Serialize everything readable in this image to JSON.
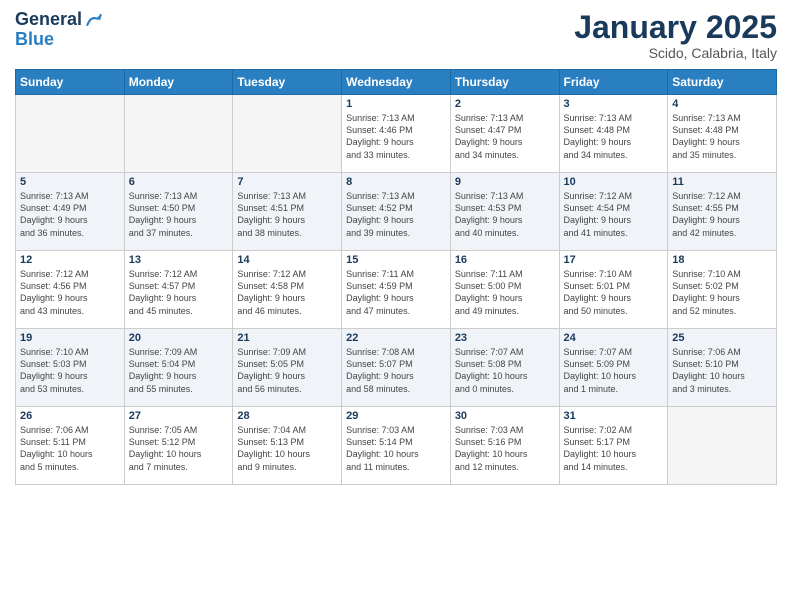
{
  "logo": {
    "general": "General",
    "blue": "Blue"
  },
  "title": "January 2025",
  "subtitle": "Scido, Calabria, Italy",
  "weekdays": [
    "Sunday",
    "Monday",
    "Tuesday",
    "Wednesday",
    "Thursday",
    "Friday",
    "Saturday"
  ],
  "weeks": [
    [
      {
        "day": "",
        "info": ""
      },
      {
        "day": "",
        "info": ""
      },
      {
        "day": "",
        "info": ""
      },
      {
        "day": "1",
        "info": "Sunrise: 7:13 AM\nSunset: 4:46 PM\nDaylight: 9 hours\nand 33 minutes."
      },
      {
        "day": "2",
        "info": "Sunrise: 7:13 AM\nSunset: 4:47 PM\nDaylight: 9 hours\nand 34 minutes."
      },
      {
        "day": "3",
        "info": "Sunrise: 7:13 AM\nSunset: 4:48 PM\nDaylight: 9 hours\nand 34 minutes."
      },
      {
        "day": "4",
        "info": "Sunrise: 7:13 AM\nSunset: 4:48 PM\nDaylight: 9 hours\nand 35 minutes."
      }
    ],
    [
      {
        "day": "5",
        "info": "Sunrise: 7:13 AM\nSunset: 4:49 PM\nDaylight: 9 hours\nand 36 minutes."
      },
      {
        "day": "6",
        "info": "Sunrise: 7:13 AM\nSunset: 4:50 PM\nDaylight: 9 hours\nand 37 minutes."
      },
      {
        "day": "7",
        "info": "Sunrise: 7:13 AM\nSunset: 4:51 PM\nDaylight: 9 hours\nand 38 minutes."
      },
      {
        "day": "8",
        "info": "Sunrise: 7:13 AM\nSunset: 4:52 PM\nDaylight: 9 hours\nand 39 minutes."
      },
      {
        "day": "9",
        "info": "Sunrise: 7:13 AM\nSunset: 4:53 PM\nDaylight: 9 hours\nand 40 minutes."
      },
      {
        "day": "10",
        "info": "Sunrise: 7:12 AM\nSunset: 4:54 PM\nDaylight: 9 hours\nand 41 minutes."
      },
      {
        "day": "11",
        "info": "Sunrise: 7:12 AM\nSunset: 4:55 PM\nDaylight: 9 hours\nand 42 minutes."
      }
    ],
    [
      {
        "day": "12",
        "info": "Sunrise: 7:12 AM\nSunset: 4:56 PM\nDaylight: 9 hours\nand 43 minutes."
      },
      {
        "day": "13",
        "info": "Sunrise: 7:12 AM\nSunset: 4:57 PM\nDaylight: 9 hours\nand 45 minutes."
      },
      {
        "day": "14",
        "info": "Sunrise: 7:12 AM\nSunset: 4:58 PM\nDaylight: 9 hours\nand 46 minutes."
      },
      {
        "day": "15",
        "info": "Sunrise: 7:11 AM\nSunset: 4:59 PM\nDaylight: 9 hours\nand 47 minutes."
      },
      {
        "day": "16",
        "info": "Sunrise: 7:11 AM\nSunset: 5:00 PM\nDaylight: 9 hours\nand 49 minutes."
      },
      {
        "day": "17",
        "info": "Sunrise: 7:10 AM\nSunset: 5:01 PM\nDaylight: 9 hours\nand 50 minutes."
      },
      {
        "day": "18",
        "info": "Sunrise: 7:10 AM\nSunset: 5:02 PM\nDaylight: 9 hours\nand 52 minutes."
      }
    ],
    [
      {
        "day": "19",
        "info": "Sunrise: 7:10 AM\nSunset: 5:03 PM\nDaylight: 9 hours\nand 53 minutes."
      },
      {
        "day": "20",
        "info": "Sunrise: 7:09 AM\nSunset: 5:04 PM\nDaylight: 9 hours\nand 55 minutes."
      },
      {
        "day": "21",
        "info": "Sunrise: 7:09 AM\nSunset: 5:05 PM\nDaylight: 9 hours\nand 56 minutes."
      },
      {
        "day": "22",
        "info": "Sunrise: 7:08 AM\nSunset: 5:07 PM\nDaylight: 9 hours\nand 58 minutes."
      },
      {
        "day": "23",
        "info": "Sunrise: 7:07 AM\nSunset: 5:08 PM\nDaylight: 10 hours\nand 0 minutes."
      },
      {
        "day": "24",
        "info": "Sunrise: 7:07 AM\nSunset: 5:09 PM\nDaylight: 10 hours\nand 1 minute."
      },
      {
        "day": "25",
        "info": "Sunrise: 7:06 AM\nSunset: 5:10 PM\nDaylight: 10 hours\nand 3 minutes."
      }
    ],
    [
      {
        "day": "26",
        "info": "Sunrise: 7:06 AM\nSunset: 5:11 PM\nDaylight: 10 hours\nand 5 minutes."
      },
      {
        "day": "27",
        "info": "Sunrise: 7:05 AM\nSunset: 5:12 PM\nDaylight: 10 hours\nand 7 minutes."
      },
      {
        "day": "28",
        "info": "Sunrise: 7:04 AM\nSunset: 5:13 PM\nDaylight: 10 hours\nand 9 minutes."
      },
      {
        "day": "29",
        "info": "Sunrise: 7:03 AM\nSunset: 5:14 PM\nDaylight: 10 hours\nand 11 minutes."
      },
      {
        "day": "30",
        "info": "Sunrise: 7:03 AM\nSunset: 5:16 PM\nDaylight: 10 hours\nand 12 minutes."
      },
      {
        "day": "31",
        "info": "Sunrise: 7:02 AM\nSunset: 5:17 PM\nDaylight: 10 hours\nand 14 minutes."
      },
      {
        "day": "",
        "info": ""
      }
    ]
  ]
}
